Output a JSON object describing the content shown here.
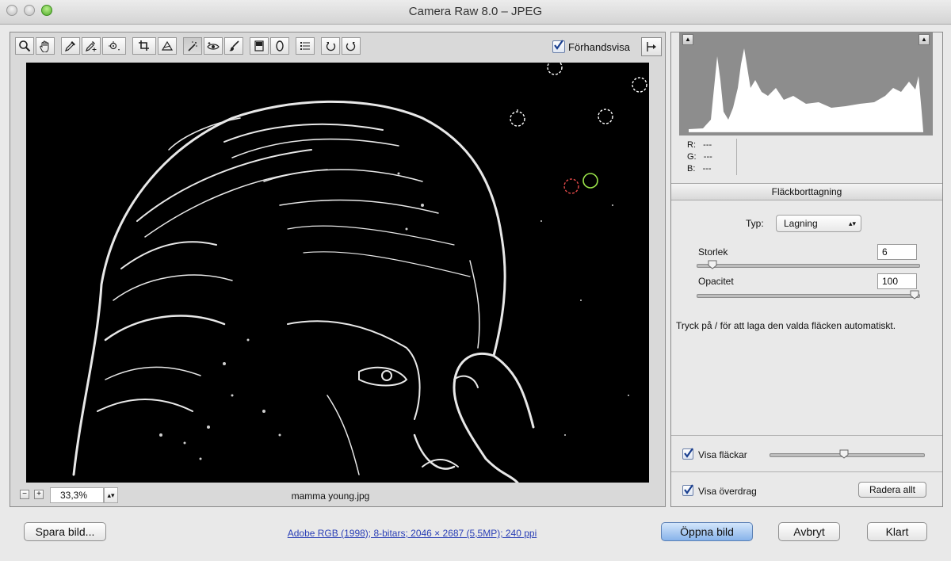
{
  "window": {
    "title": "Camera Raw 8.0  –  JPEG"
  },
  "toolbar": {
    "tools": [
      {
        "name": "zoom-tool",
        "icon": "magnifier-icon"
      },
      {
        "name": "hand-tool",
        "icon": "hand-icon"
      },
      {
        "name": "white-balance-tool",
        "icon": "eyedropper-icon"
      },
      {
        "name": "color-sampler-tool",
        "icon": "eyedropper-plus-icon"
      },
      {
        "name": "targeted-adjustment-tool",
        "icon": "target-icon"
      },
      {
        "name": "crop-tool",
        "icon": "crop-icon"
      },
      {
        "name": "straighten-tool",
        "icon": "straighten-icon"
      },
      {
        "name": "spot-removal-tool",
        "icon": "spot-removal-icon"
      },
      {
        "name": "red-eye-tool",
        "icon": "eye-icon"
      },
      {
        "name": "adjustment-brush-tool",
        "icon": "brush-icon"
      },
      {
        "name": "graduated-filter-tool",
        "icon": "graduated-filter-icon"
      },
      {
        "name": "radial-filter-tool",
        "icon": "radial-filter-icon"
      },
      {
        "name": "preferences-tool",
        "icon": "list-icon"
      },
      {
        "name": "rotate-left-tool",
        "icon": "rotate-ccw-icon"
      },
      {
        "name": "rotate-right-tool",
        "icon": "rotate-cw-icon"
      }
    ],
    "active_tool": "spot-removal-tool",
    "preview_label": "Förhandsvisa",
    "preview_checked": true
  },
  "status": {
    "zoom_value": "33,3%",
    "filename": "mamma young.jpg"
  },
  "histogram": {
    "r_label": "R:",
    "g_label": "G:",
    "b_label": "B:",
    "r_value": "---",
    "g_value": "---",
    "b_value": "---"
  },
  "spot_removal": {
    "section_title": "Fläckborttagning",
    "type_label": "Typ:",
    "type_value": "Lagning",
    "size_label": "Storlek",
    "size_value": "6",
    "size_level": 0.05,
    "opacity_label": "Opacitet",
    "opacity_value": "100",
    "opacity_level": 1.0,
    "hint": "Tryck på / för att laga den valda fläcken automatiskt.",
    "show_spots_label": "Visa fläckar",
    "show_spots_checked": true,
    "show_spots_level": 0.48,
    "show_overlay_label": "Visa överdrag",
    "show_overlay_checked": true,
    "clear_all_label": "Radera allt"
  },
  "footer": {
    "save_label": "Spara bild...",
    "info_link": "Adobe RGB (1998); 8-bitars; 2046 × 2687 (5,5MP); 240 ppi",
    "open_label": "Öppna bild",
    "cancel_label": "Avbryt",
    "done_label": "Klart"
  },
  "colors": {
    "accent": "#87b3ea",
    "spot_source": "#e34a4a",
    "spot_target": "#9be44a"
  }
}
